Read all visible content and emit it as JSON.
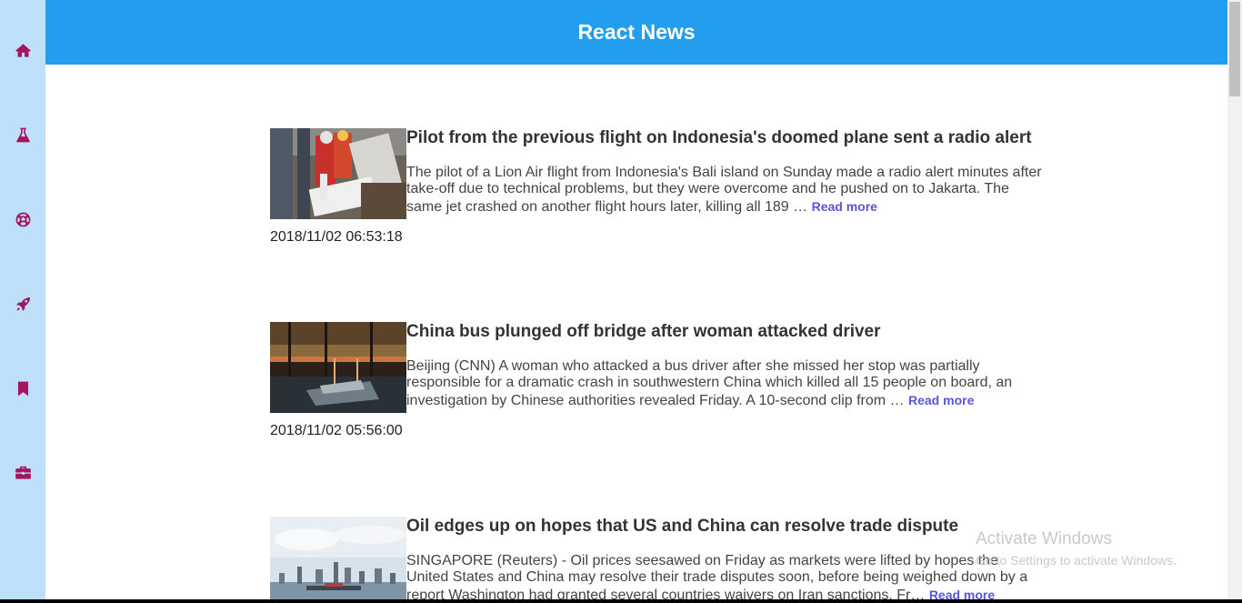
{
  "header": {
    "title": "React News"
  },
  "sidebar": {
    "items": [
      {
        "icon": "home-icon"
      },
      {
        "icon": "flask-icon"
      },
      {
        "icon": "soccer-ball-icon"
      },
      {
        "icon": "rocket-icon"
      },
      {
        "icon": "bookmark-icon"
      },
      {
        "icon": "briefcase-icon"
      }
    ]
  },
  "articles": [
    {
      "title": "Pilot from the previous flight on Indonesia's doomed plane sent a radio alert",
      "description": "The pilot of a Lion Air flight from Indonesia's Bali island on Sunday made a radio alert minutes after take-off due to technical problems, but they were overcome and he pushed on to Jakarta. The same jet crashed on another flight hours later, killing all 189 …",
      "read_more": "Read more",
      "date": "2018/11/02 06:53:18"
    },
    {
      "title": "China bus plunged off bridge after woman attacked driver",
      "description": "Beijing (CNN) A woman who attacked a bus driver after she missed her stop was partially responsible for a dramatic crash in southwestern China which killed all 15 people on board, an investigation by Chinese authorities revealed Friday. A 10-second clip from …",
      "read_more": "Read more",
      "date": "2018/11/02 05:56:00"
    },
    {
      "title": "Oil edges up on hopes that US and China can resolve trade dispute",
      "description": "SINGAPORE (Reuters) - Oil prices seesawed on Friday as markets were lifted by hopes the United States and China may resolve their trade disputes soon, before being weighed down by a report Washington had granted several countries waivers on Iran sanctions. Fr…",
      "read_more": "Read more",
      "date": ""
    }
  ],
  "watermark": {
    "line1": "Activate Windows",
    "line2": "Go to Settings to activate Windows."
  },
  "colors": {
    "header_bg": "#239dee",
    "sidebar_bg": "#bfe0fb",
    "icon": "#a3155f",
    "read_more": "#5a55d6"
  }
}
